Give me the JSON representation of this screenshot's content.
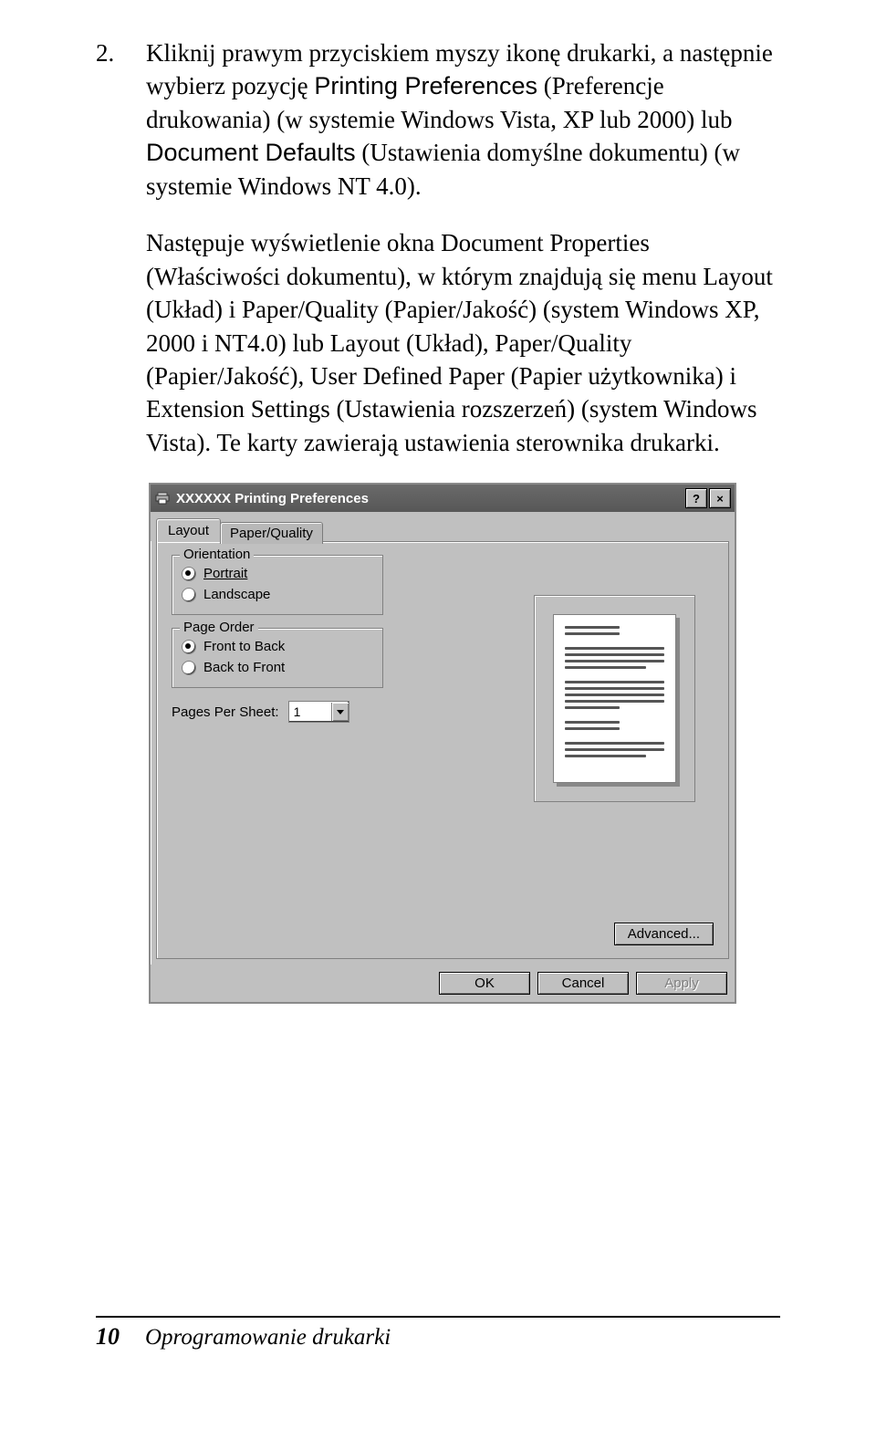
{
  "list_number": "2.",
  "body": {
    "p1_a": "Kliknij prawym przyciskiem myszy ikonę drukarki, a następnie wybierz pozycję ",
    "p1_sans1": "Printing Preferences",
    "p1_b": " (Preferencje drukowania) (w systemie Windows Vista, XP lub 2000) lub ",
    "p1_sans2": "Document Defaults",
    "p1_c": " (Ustawienia domyślne dokumentu) (w systemie Windows NT 4.0).",
    "p2": "Następuje wyświetlenie okna Document Properties (Właściwości dokumentu), w którym znajdują się menu Layout (Układ) i Paper/Quality (Papier/Jakość) (system Windows XP, 2000 i NT4.0) lub Layout (Układ), Paper/Quality (Papier/Jakość), User Defined Paper (Papier użytkownika) i Extension Settings (Ustawienia rozszerzeń) (system Windows Vista). Te karty zawierają ustawienia sterownika drukarki."
  },
  "dialog": {
    "title": "XXXXXX Printing Preferences",
    "help": "?",
    "close": "×",
    "tabs": {
      "layout": "Layout",
      "paper": "Paper/Quality"
    },
    "orientation": {
      "legend": "Orientation",
      "portrait": "Portrait",
      "landscape": "Landscape"
    },
    "pageorder": {
      "legend": "Page Order",
      "ftb": "Front to Back",
      "btf": "Back to Front"
    },
    "pps_label": "Pages Per Sheet:",
    "pps_value": "1",
    "advanced": "Advanced...",
    "ok": "OK",
    "cancel": "Cancel",
    "apply": "Apply"
  },
  "footer": {
    "page": "10",
    "title": "Oprogramowanie drukarki"
  }
}
